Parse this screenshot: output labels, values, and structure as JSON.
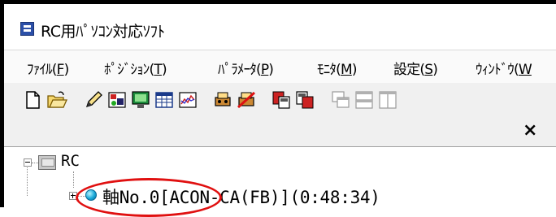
{
  "window": {
    "title": "RC用ﾊﾟｿｺﾝ対応ｿﾌﾄ",
    "app_icon": "rc-app-icon"
  },
  "menu": {
    "items": [
      {
        "label": "ﾌｧｲﾙ(",
        "key": "F",
        "suffix": ")"
      },
      {
        "label": "ﾎﾟｼﾞｼｮﾝ(",
        "key": "T",
        "suffix": ")"
      },
      {
        "label": "ﾊﾟﾗﾒｰﾀ(",
        "key": "P",
        "suffix": ")"
      },
      {
        "label": "ﾓﾆﾀ(",
        "key": "M",
        "suffix": ")"
      },
      {
        "label": "設定(",
        "key": "S",
        "suffix": ")"
      },
      {
        "label": "ｳｨﾝﾄﾞｳ(",
        "key": "W",
        "suffix": ""
      }
    ]
  },
  "toolbar": {
    "buttons": [
      "new-file-icon",
      "open-folder-icon",
      "edit-pencil-icon",
      "position-data-icon",
      "monitor-icon",
      "table-icon",
      "chart-icon",
      "axis-connect-icon",
      "axis-disconnect-icon",
      "copy-to-controller-icon",
      "copy-from-controller-icon",
      "cascade-icon",
      "tile-horizontal-icon",
      "tile-vertical-icon"
    ]
  },
  "panel": {
    "close_label": "×"
  },
  "tree": {
    "root_label": "RC",
    "axis_label": "軸No.0[ACON-CA(FB)](0:48:34)"
  },
  "colors": {
    "highlight_circle": "#e01010",
    "status_dot": "#18a8d8"
  }
}
